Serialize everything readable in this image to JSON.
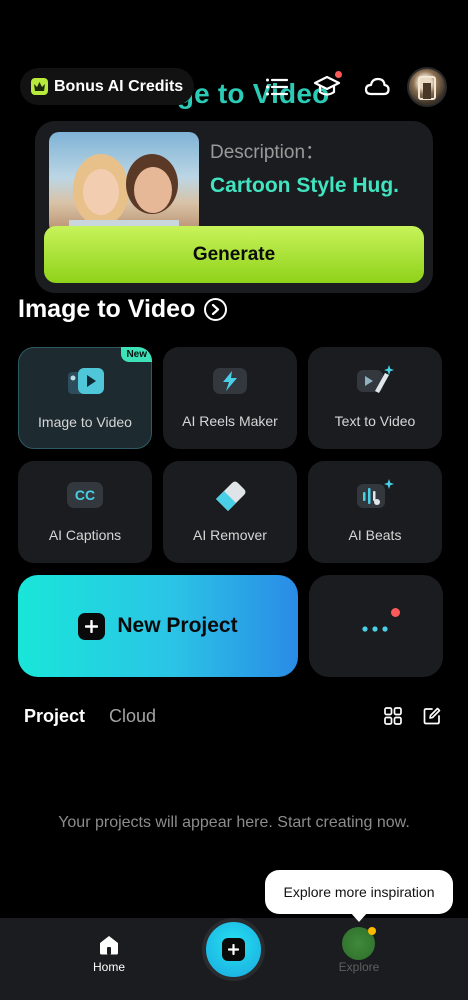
{
  "top_bar": {
    "bonus_label": "Bonus AI Credits",
    "icons": [
      "crown-icon",
      "list-icon",
      "graduation-cap-icon",
      "cloud-icon"
    ]
  },
  "hero": {
    "title": "Image to Video",
    "description_label": "Description：",
    "description_value": "Cartoon Style Hug.",
    "generate_label": "Generate"
  },
  "section": {
    "title": "Image to Video"
  },
  "tools": [
    {
      "label": "Image to Video",
      "icon": "image-to-video-icon",
      "badge": "New",
      "selected": true
    },
    {
      "label": "AI Reels Maker",
      "icon": "reels-lightning-icon"
    },
    {
      "label": "Text  to Video",
      "icon": "text-to-video-icon"
    },
    {
      "label": "AI Captions",
      "icon": "captions-cc-icon"
    },
    {
      "label": "AI Remover",
      "icon": "eraser-icon"
    },
    {
      "label": "AI Beats",
      "icon": "beats-icon"
    }
  ],
  "actions": {
    "new_project_label": "New Project",
    "more_icon": "more-dots-icon"
  },
  "projects": {
    "tabs": [
      "Project",
      "Cloud"
    ],
    "empty_message": "Your projects will appear here. Start creating now."
  },
  "tooltip": {
    "text": "Explore more inspiration"
  },
  "bottom_nav": {
    "home_label": "Home",
    "explore_label": "Explore"
  },
  "colors": {
    "accent_green": "#b8ea3e",
    "accent_teal": "#40e4c0",
    "new_project_gradient": [
      "#19e6d9",
      "#2a8be6"
    ],
    "notification_dot": "#ff5a5a"
  }
}
